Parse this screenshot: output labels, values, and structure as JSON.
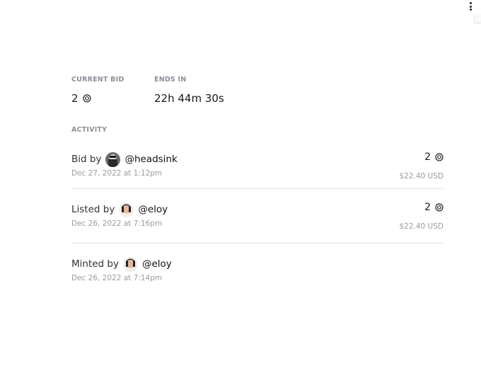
{
  "stats": {
    "current_bid_label": "CURRENT BID",
    "current_bid_value": "2",
    "ends_in_label": "ENDS IN",
    "ends_in_value": "22h 44m 30s"
  },
  "activity": {
    "label": "ACTIVITY",
    "items": [
      {
        "prefix": "Bid by",
        "handle": "@headsink",
        "date": "Dec 27, 2022 at 1:12pm",
        "price": "2",
        "usd": "$22.40 USD"
      },
      {
        "prefix": "Listed by",
        "handle": "@eloy",
        "date": "Dec 26, 2022 at 7:16pm",
        "price": "2",
        "usd": "$22.40 USD"
      },
      {
        "prefix": "Minted by",
        "handle": "@eloy",
        "date": "Dec 26, 2022 at 7:14pm"
      }
    ]
  },
  "icons": {
    "currency": "tezos-currency-icon",
    "menu": "more-vertical-icon"
  },
  "colors": {
    "muted": "#8e8e99",
    "divider": "#e6e6ea",
    "text": "#1a1a1a"
  }
}
